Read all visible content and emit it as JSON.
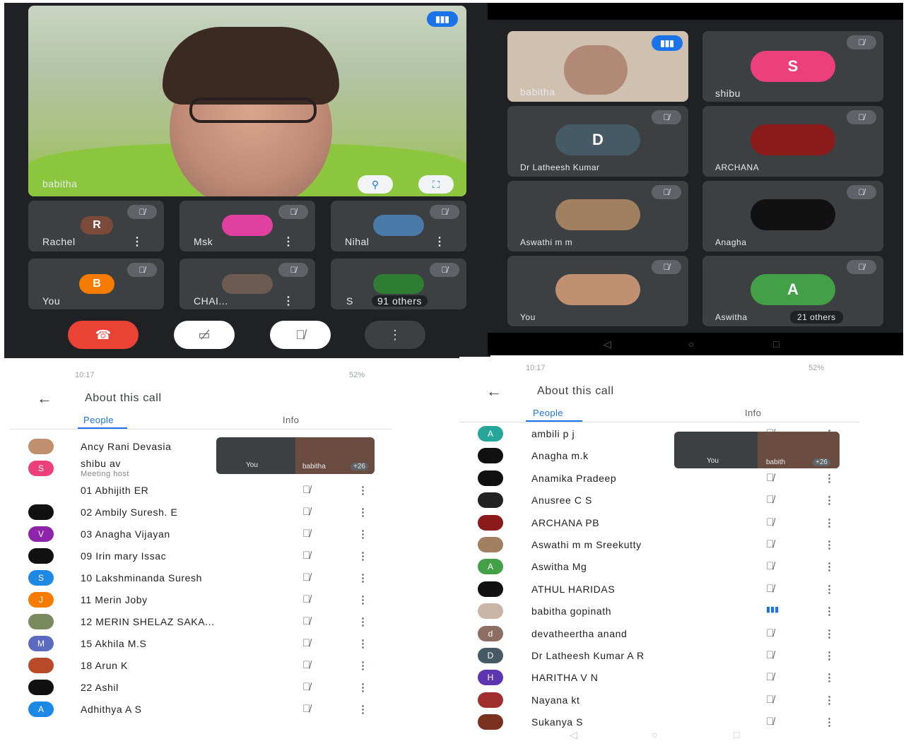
{
  "call_main": {
    "featured_name": "babitha",
    "tiles": [
      {
        "name": "Rachel",
        "initial": "R",
        "color": "#7b4a3a"
      },
      {
        "name": "Msk",
        "initial": "",
        "color": "#e040a0"
      },
      {
        "name": "Nihal",
        "initial": "",
        "color": "#4a7aa8"
      },
      {
        "name": "You",
        "initial": "B",
        "color": "#f57c00"
      },
      {
        "name": "CHAI...",
        "initial": "",
        "color": "#6d5a50"
      },
      {
        "name": "S",
        "initial": "",
        "color": "#2e7d32",
        "others": "91 others"
      }
    ]
  },
  "call_grid": {
    "tiles": [
      {
        "name": "babitha",
        "initial": "",
        "color": "#c8b5a6"
      },
      {
        "name": "shibu",
        "initial": "S",
        "color": "#ec407a"
      },
      {
        "name": "Dr Latheesh Kumar",
        "initial": "D",
        "color": "#455a64"
      },
      {
        "name": "ARCHANA",
        "initial": "",
        "color": "#8b1a1a"
      },
      {
        "name": "Aswathi m m",
        "initial": "",
        "color": "#a08060"
      },
      {
        "name": "Anagha",
        "initial": "",
        "color": "#111111"
      },
      {
        "name": "You",
        "initial": "",
        "color": "#c09070"
      },
      {
        "name": "Aswitha",
        "initial": "A",
        "color": "#43a047",
        "others": "21 others"
      }
    ],
    "nav": [
      "◁",
      "○",
      "□"
    ]
  },
  "list_left": {
    "time": "10:17",
    "battery": "52%",
    "title": "About this call",
    "tabs": [
      "People",
      "Info"
    ],
    "pip_you": "You",
    "pip_name": "babitha",
    "pip_count": "+26",
    "people": [
      {
        "name": "Ancy Rani Devasia",
        "color": "#c09070",
        "initial": ""
      },
      {
        "name": "shibu av",
        "sub": "Meeting host",
        "color": "#ec407a",
        "initial": "S"
      },
      {
        "name": "01 Abhijith ER",
        "color": "#ffffff",
        "initial": ""
      },
      {
        "name": "02 Ambily Suresh. E",
        "color": "#111111",
        "initial": ""
      },
      {
        "name": "03 Anagha Vijayan",
        "color": "#8e24aa",
        "initial": "V"
      },
      {
        "name": "09 Irin mary Issac",
        "color": "#111111",
        "initial": ""
      },
      {
        "name": "10 Lakshminanda Suresh",
        "color": "#1e88e5",
        "initial": "S"
      },
      {
        "name": "11 Merin Joby",
        "color": "#f57c00",
        "initial": "J"
      },
      {
        "name": "12 MERIN SHELAZ SAKA...",
        "color": "#7a8a60",
        "initial": ""
      },
      {
        "name": "15 Akhila M.S",
        "color": "#5c6bc0",
        "initial": "M"
      },
      {
        "name": "18 Arun K",
        "color": "#b84a2a",
        "initial": ""
      },
      {
        "name": "22 Ashil",
        "color": "#111111",
        "initial": ""
      },
      {
        "name": "Adhithya A S",
        "color": "#1e88e5",
        "initial": "A"
      }
    ]
  },
  "list_right": {
    "time": "10:17",
    "battery": "52%",
    "title": "About this call",
    "tabs": [
      "People",
      "Info"
    ],
    "pip_you": "You",
    "pip_name": "babith",
    "pip_count": "+26",
    "people": [
      {
        "name": "ambili p j",
        "color": "#26a69a",
        "initial": "A"
      },
      {
        "name": "Anagha m.k",
        "color": "#111111",
        "initial": ""
      },
      {
        "name": "Anamika Pradeep",
        "color": "#111111",
        "initial": ""
      },
      {
        "name": "Anusree C S",
        "color": "#222222",
        "initial": ""
      },
      {
        "name": "ARCHANA PB",
        "color": "#8b1a1a",
        "initial": ""
      },
      {
        "name": "Aswathi m m Sreekutty",
        "color": "#a08060",
        "initial": ""
      },
      {
        "name": "Aswitha Mg",
        "color": "#43a047",
        "initial": "A"
      },
      {
        "name": "ATHUL HARIDAS",
        "color": "#111111",
        "initial": ""
      },
      {
        "name": "babitha gopinath",
        "color": "#c8b5a6",
        "initial": ""
      },
      {
        "name": "devatheertha anand",
        "color": "#8d6e63",
        "initial": "d"
      },
      {
        "name": "Dr Latheesh Kumar A R",
        "color": "#455a64",
        "initial": "D"
      },
      {
        "name": "HARITHA V N",
        "color": "#5e35b1",
        "initial": "H"
      },
      {
        "name": "Nayana kt",
        "color": "#a03030",
        "initial": ""
      },
      {
        "name": "Sukanya S",
        "color": "#7a3020",
        "initial": ""
      }
    ]
  }
}
